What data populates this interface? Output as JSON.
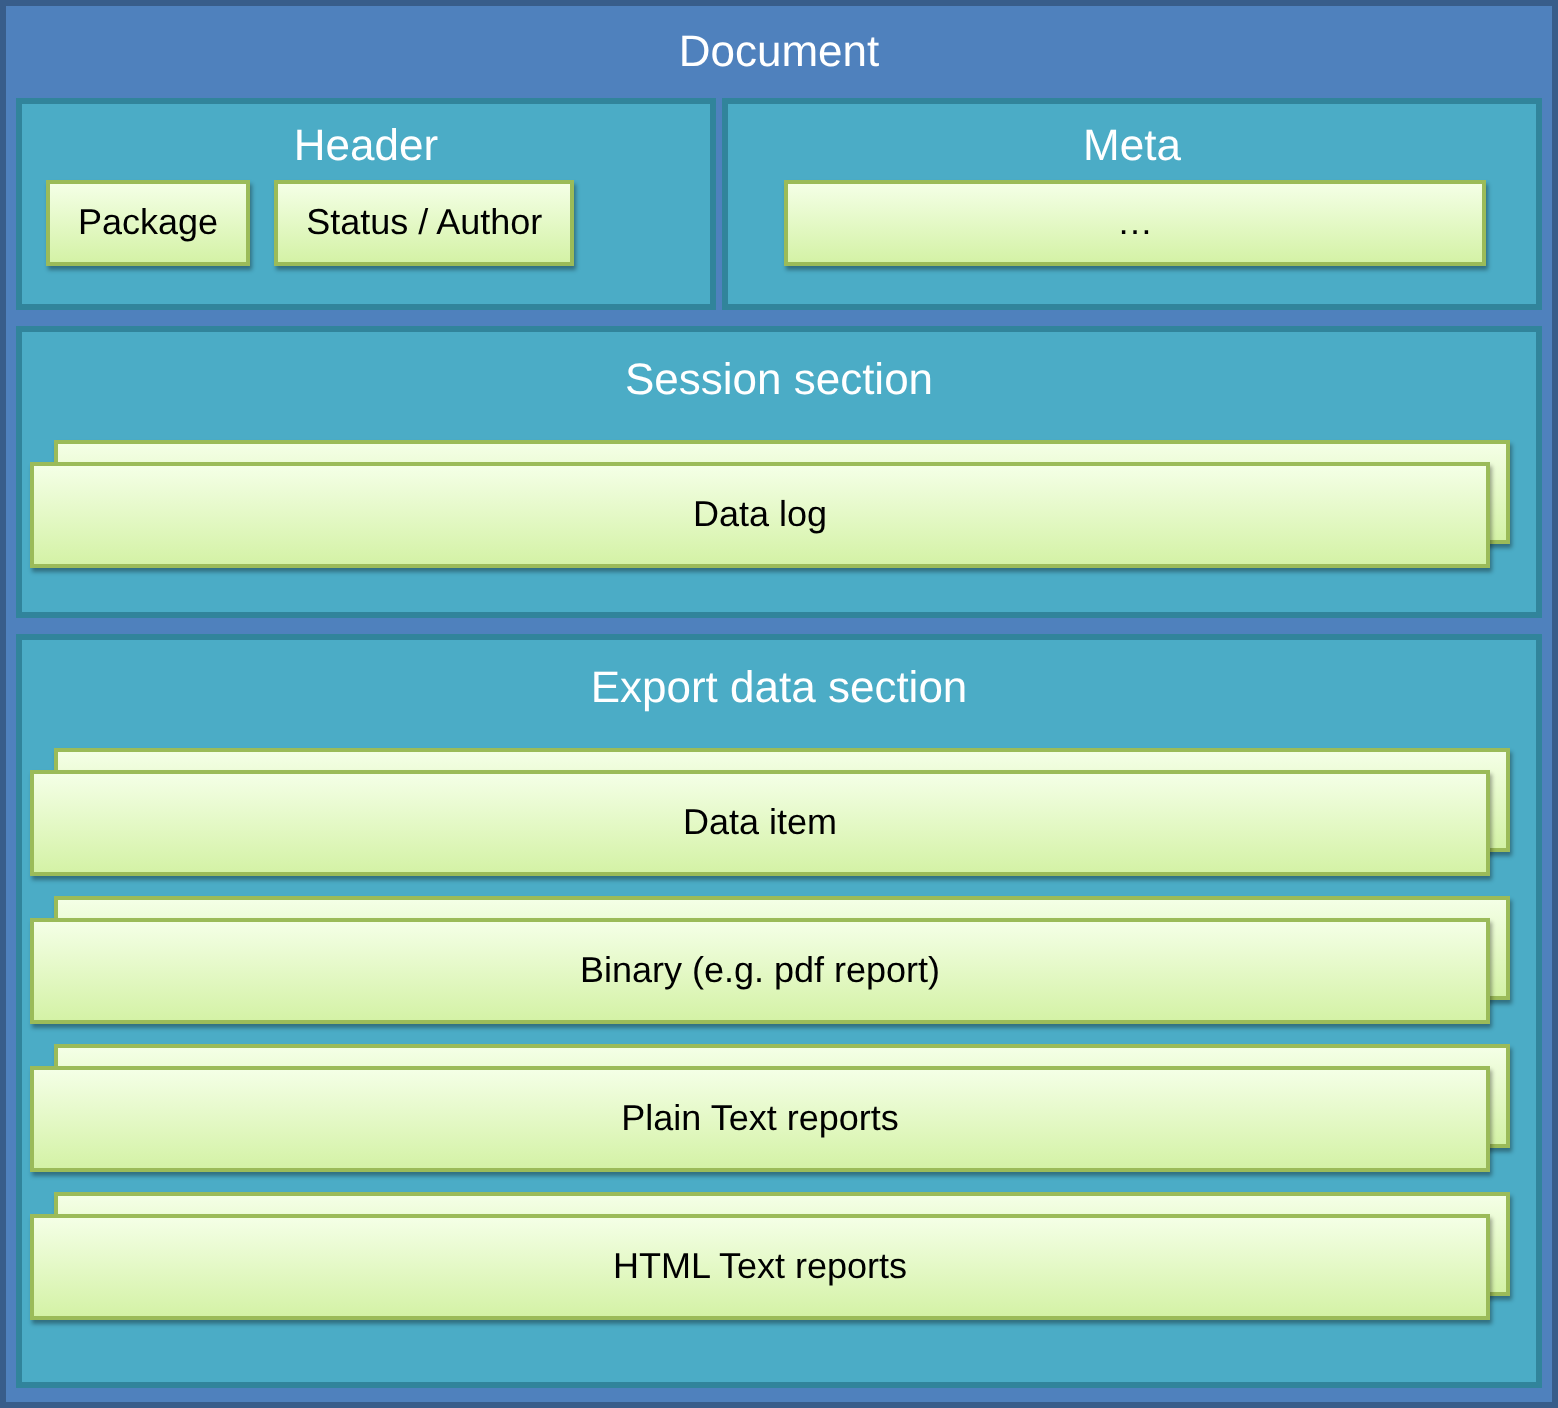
{
  "title": "Document",
  "panels": [
    {
      "title": "Header",
      "items": [
        {
          "label": "Package"
        },
        {
          "label": "Status / Author"
        }
      ]
    },
    {
      "title": "Meta",
      "items": [
        {
          "label": "…"
        }
      ]
    }
  ],
  "sections": [
    {
      "title": "Session section",
      "items": [
        {
          "label": "Data log",
          "stacked": true
        }
      ]
    },
    {
      "title": "Export data section",
      "items": [
        {
          "label": "Data item",
          "stacked": true
        },
        {
          "label": "Binary (e.g. pdf report)",
          "stacked": true
        },
        {
          "label": "Plain Text reports",
          "stacked": true
        },
        {
          "label": "HTML Text reports",
          "stacked": true
        }
      ]
    }
  ]
}
